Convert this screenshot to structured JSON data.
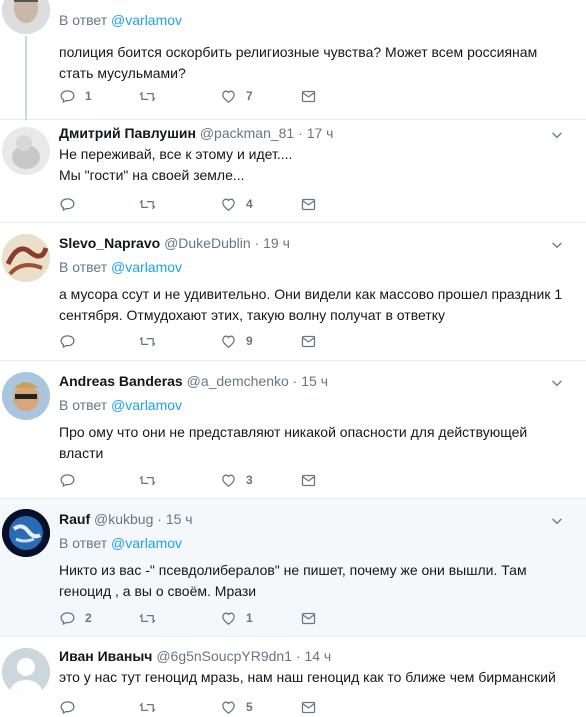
{
  "tweets": [
    {
      "reply_prefix": "В ответ",
      "reply_to": "@varlamov",
      "lines": [
        "полиция боится оскорбить религиозные чувства? Может всем россиянам",
        "стать мусульмами?"
      ],
      "counts": {
        "reply": "1",
        "retweet": "",
        "like": "7"
      }
    },
    {
      "name": "Дмитрий Павлушин",
      "handle": "@packman_81",
      "dot": "·",
      "time": "17 ч",
      "lines": [
        "Не переживай, все к этому и идет....",
        "Мы \"гости\" на своей земле..."
      ],
      "counts": {
        "reply": "",
        "retweet": "",
        "like": "4"
      }
    },
    {
      "name": "Slevo_Napravo",
      "handle": "@DukeDublin",
      "dot": "·",
      "time": "19 ч",
      "reply_prefix": "В ответ",
      "reply_to": "@varlamov",
      "lines": [
        "а мусора ссут и не удивительно. Они видели как массово прошел праздник 1",
        "сентября. Отмудохают этих, такую волну получат в ответку"
      ],
      "counts": {
        "reply": "",
        "retweet": "",
        "like": "9"
      }
    },
    {
      "name": "Andreas Banderas",
      "handle": "@a_demchenko",
      "dot": "·",
      "time": "15 ч",
      "reply_prefix": "В ответ",
      "reply_to": "@varlamov",
      "lines": [
        "Про ому что они не представляют никакой опасности для действующей",
        "власти"
      ],
      "counts": {
        "reply": "",
        "retweet": "",
        "like": "3"
      }
    },
    {
      "name": "Rauf",
      "handle": "@kukbug",
      "dot": "·",
      "time": "15 ч",
      "reply_prefix": "В ответ",
      "reply_to": "@varlamov",
      "lines": [
        "Никто из вас -\" псевдолибералов\" не пишет, почему же они вышли. Там",
        "геноцид , а вы о своём. Мрази"
      ],
      "counts": {
        "reply": "2",
        "retweet": "",
        "like": "1"
      }
    },
    {
      "name": "Иван Иваныч",
      "handle": "@6g5nSoucpYR9dn1",
      "dot": "·",
      "time": "14 ч",
      "lines": [
        "это у нас тут геноцид мразь, нам наш геноцид как то ближе чем бирманский"
      ],
      "counts": {
        "reply": "",
        "retweet": "",
        "like": "5"
      }
    }
  ],
  "colors": {
    "link": "#1da1f2",
    "muted": "#657786",
    "highlight": "#f5f8fa"
  },
  "icons": [
    "reply-icon",
    "retweet-icon",
    "like-icon",
    "message-icon",
    "chevron-down-icon"
  ]
}
